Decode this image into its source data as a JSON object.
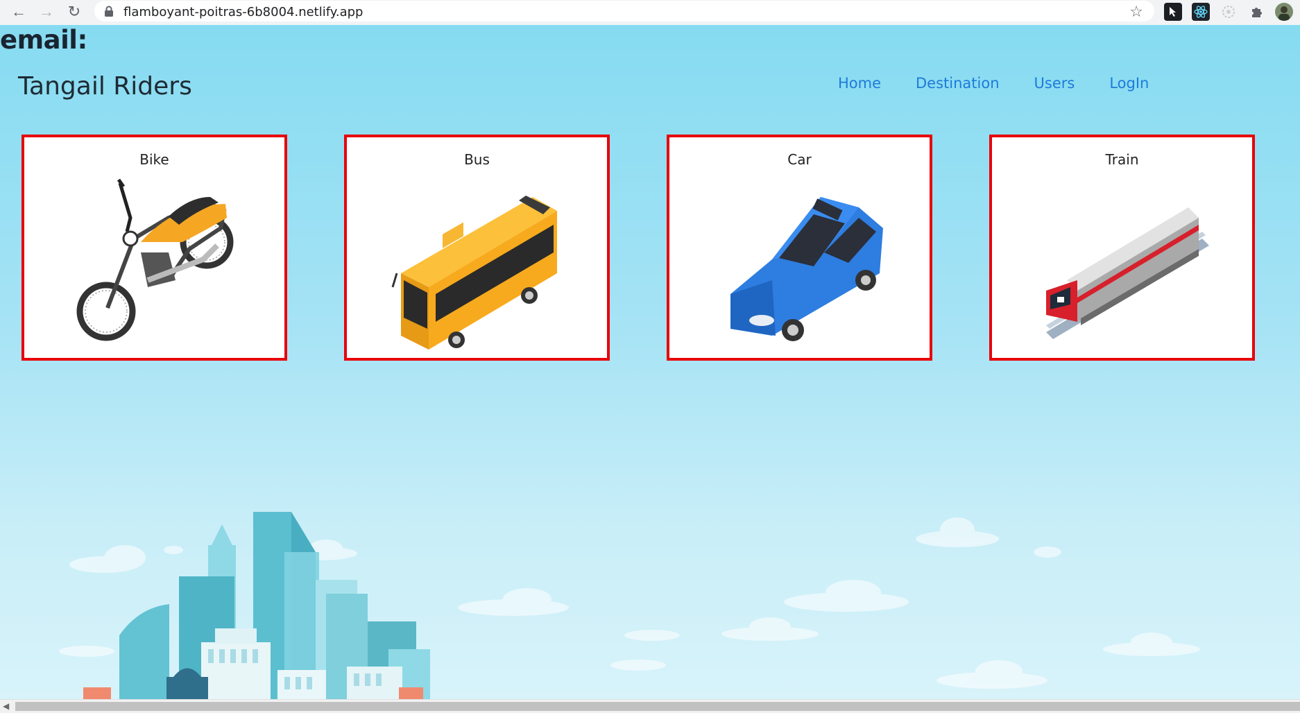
{
  "browser": {
    "url": "flamboyant-poitras-6b8004.netlify.app"
  },
  "page": {
    "email_label": "email:",
    "brand": "Tangail Riders",
    "nav": [
      {
        "label": "Home"
      },
      {
        "label": "Destination"
      },
      {
        "label": "Users"
      },
      {
        "label": "LogIn"
      }
    ],
    "vehicles": [
      {
        "label": "Bike",
        "icon": "motorcycle-icon",
        "color": "#f5a623"
      },
      {
        "label": "Bus",
        "icon": "bus-icon",
        "color": "#fbb22a"
      },
      {
        "label": "Car",
        "icon": "car-icon",
        "color": "#2e7de0"
      },
      {
        "label": "Train",
        "icon": "train-icon",
        "color": "#d7202b"
      }
    ]
  },
  "colors": {
    "card_border": "#e8000a",
    "nav_link": "#1d7bd8",
    "sky_top": "#86dbf1",
    "sky_bottom": "#d8f3fa"
  }
}
